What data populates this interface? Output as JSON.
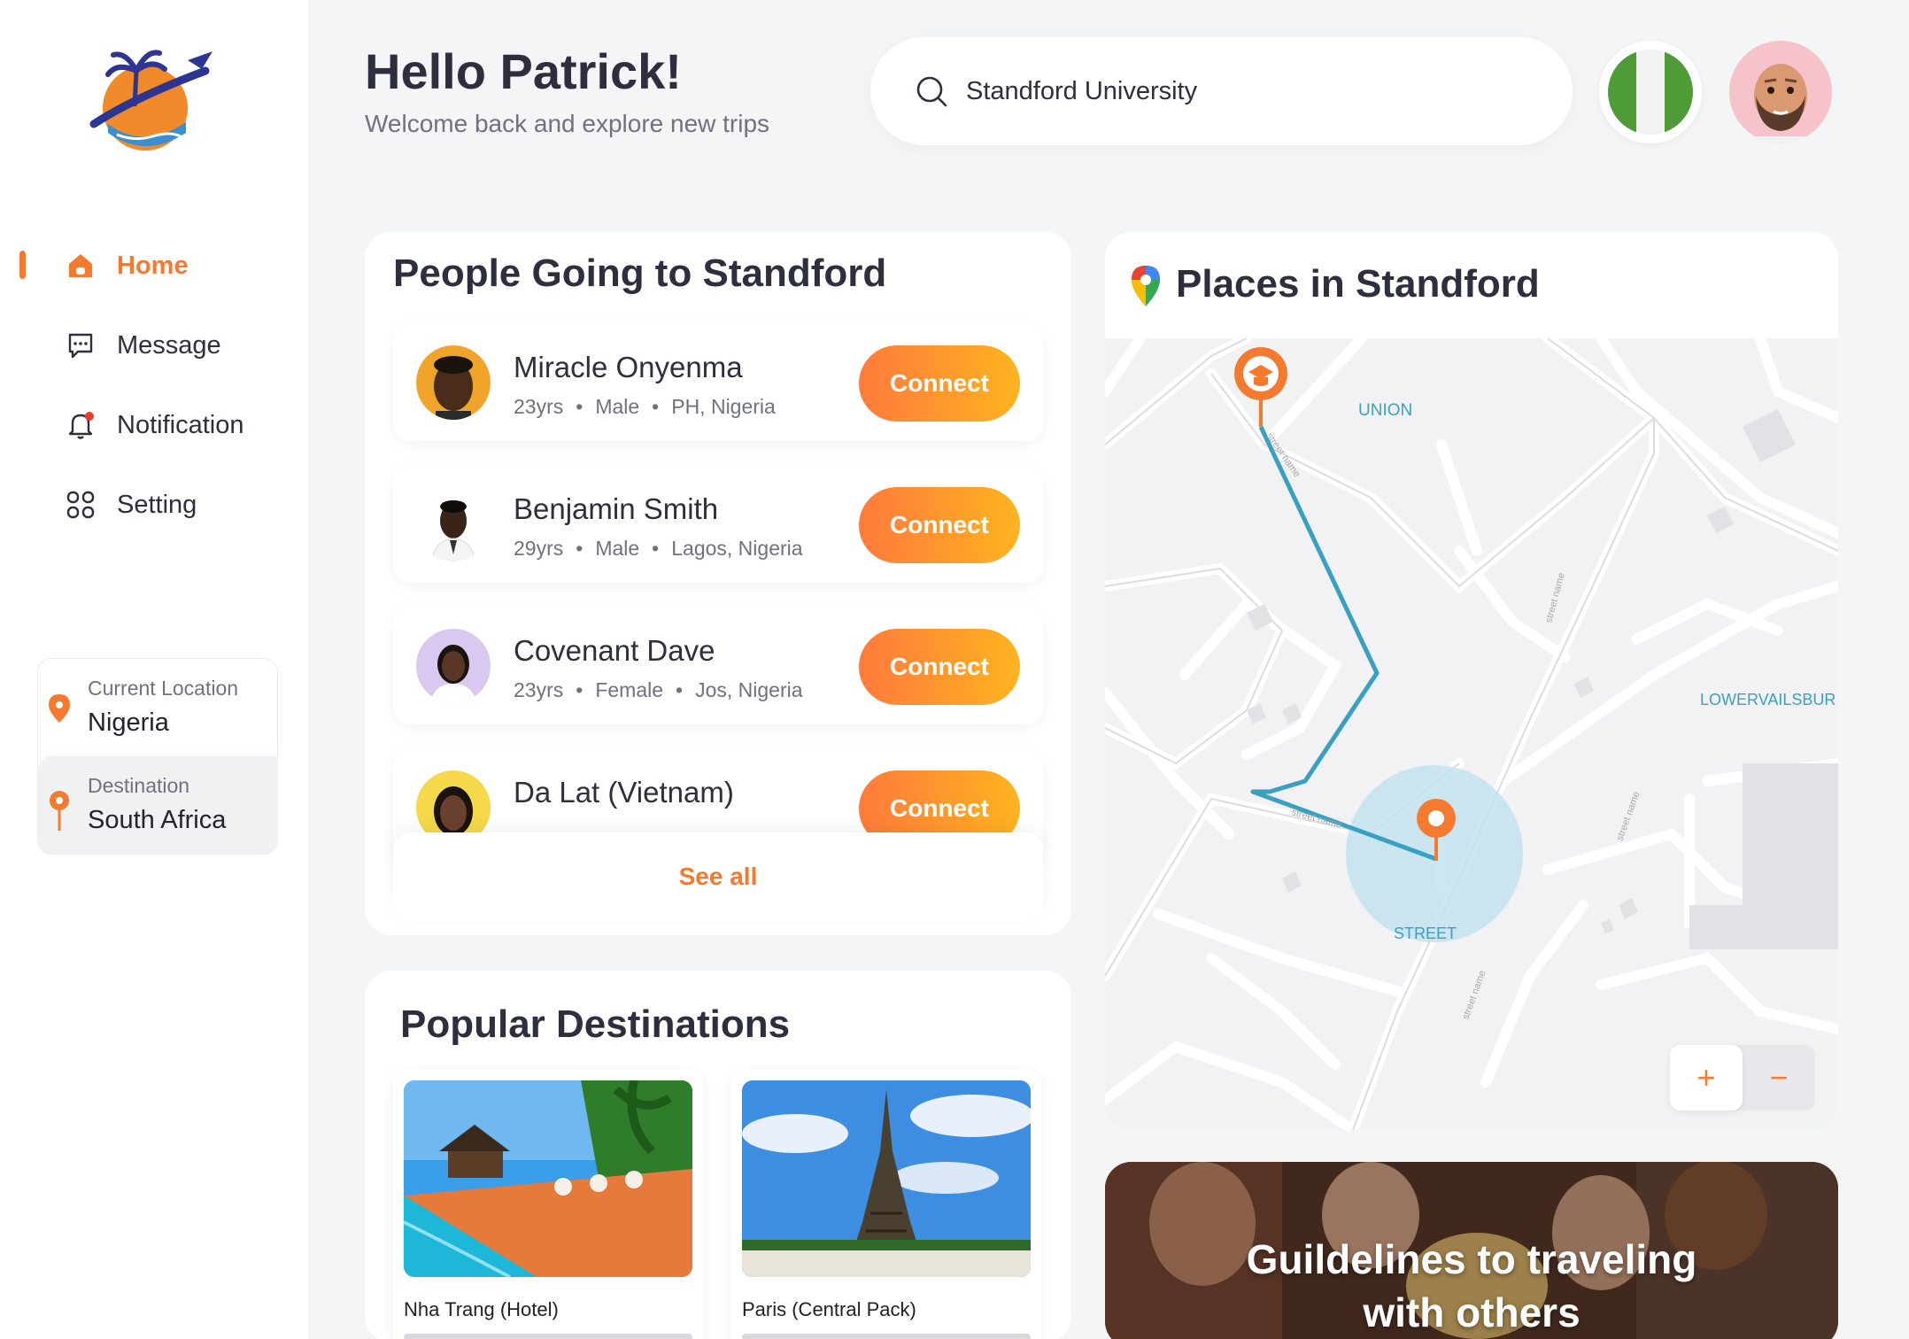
{
  "sidebar": {
    "nav": [
      {
        "label": "Home",
        "icon": "home-icon",
        "active": true
      },
      {
        "label": "Message",
        "icon": "chat-bubble-icon"
      },
      {
        "label": "Notification",
        "icon": "bell-icon"
      },
      {
        "label": "Setting",
        "icon": "grid-icon"
      }
    ],
    "location": {
      "current_label": "Current Location",
      "current_value": "Nigeria",
      "destination_label": "Destination",
      "destination_value": "South Africa"
    }
  },
  "header": {
    "greeting": "Hello Patrick!",
    "subtitle": "Welcome back and explore new trips",
    "search_value": "Standford University",
    "flag": "nigeria-flag-icon",
    "avatar": "user-avatar"
  },
  "people": {
    "title": "People Going to Standford",
    "items": [
      {
        "name": "Miracle Onyenma",
        "age": "23yrs",
        "gender": "Male",
        "place": "PH, Nigeria",
        "button": "Connect"
      },
      {
        "name": "Benjamin Smith",
        "age": "29yrs",
        "gender": "Male",
        "place": "Lagos, Nigeria",
        "button": "Connect"
      },
      {
        "name": "Covenant Dave",
        "age": "23yrs",
        "gender": "Female",
        "place": "Jos, Nigeria",
        "button": "Connect"
      },
      {
        "name": "Da Lat (Vietnam)",
        "age": "",
        "gender": "",
        "place": "",
        "button": "Connect"
      }
    ],
    "see_all": "See all"
  },
  "popular": {
    "title": "Popular Destinations",
    "items": [
      {
        "name": "Nha Trang (Hotel)"
      },
      {
        "name": "Paris (Central Pack)"
      }
    ]
  },
  "map": {
    "title": "Places in Standford",
    "labels": {
      "union": "UNION",
      "lower": "LOWERVAILSBUR",
      "street": "STREET",
      "street_name": "street name"
    },
    "zoom_in": "+",
    "zoom_out": "−"
  },
  "guide": {
    "title_line1": "Guildelines to traveling",
    "title_line2": "with others"
  },
  "colors": {
    "accent": "#f47a2f",
    "gradient_start": "#ff7a3c",
    "gradient_end": "#ffb41f",
    "route": "#3aa0c1"
  }
}
